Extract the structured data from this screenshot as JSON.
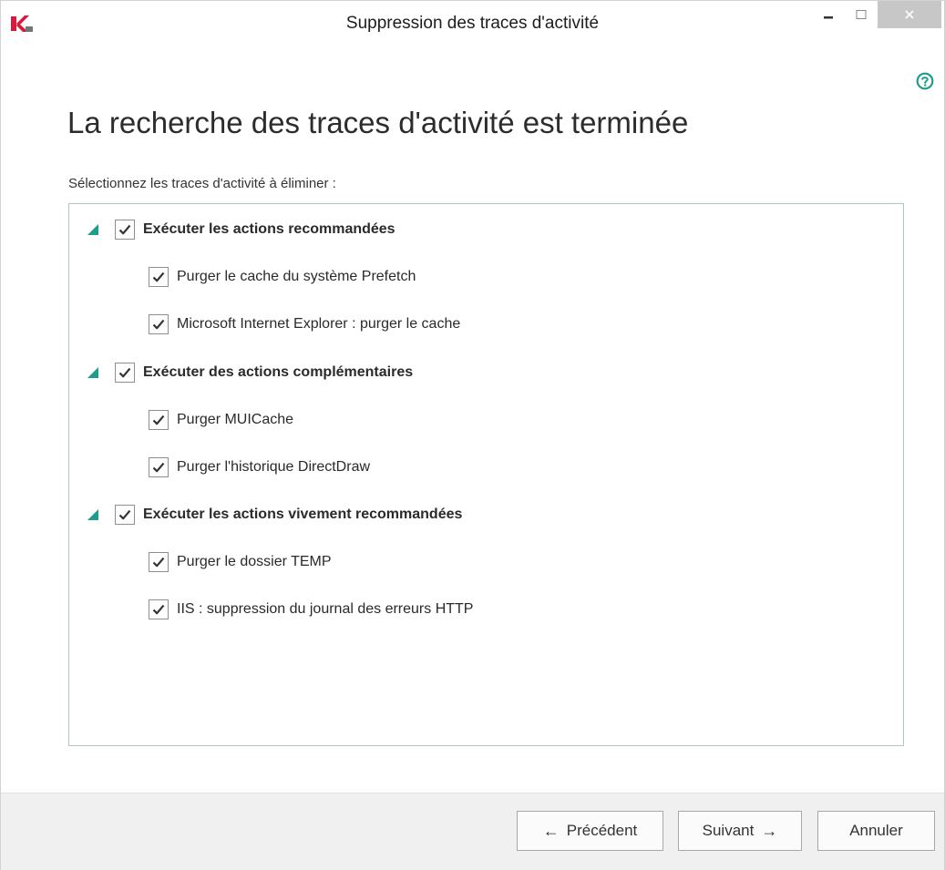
{
  "window": {
    "title": "Suppression des traces d'activité"
  },
  "header": {
    "title": "La recherche des traces d'activité est terminée",
    "subtitle": "Sélectionnez les traces d'activité à éliminer :"
  },
  "groups": [
    {
      "label": "Exécuter les actions recommandées",
      "checked": true,
      "items": [
        {
          "label": "Purger le cache du système Prefetch",
          "checked": true
        },
        {
          "label": "Microsoft Internet Explorer : purger le cache",
          "checked": true
        }
      ]
    },
    {
      "label": "Exécuter des actions complémentaires",
      "checked": true,
      "items": [
        {
          "label": "Purger MUICache",
          "checked": true
        },
        {
          "label": "Purger l'historique DirectDraw",
          "checked": true
        }
      ]
    },
    {
      "label": "Exécuter les actions vivement recommandées",
      "checked": true,
      "items": [
        {
          "label": "Purger le dossier TEMP",
          "checked": true
        },
        {
          "label": "IIS : suppression du journal des erreurs HTTP",
          "checked": true
        }
      ]
    }
  ],
  "footer": {
    "prev_label": "Précédent",
    "next_label": "Suivant",
    "cancel_label": "Annuler",
    "prev_arrow": "←",
    "next_arrow": "→"
  },
  "colors": {
    "accent": "#1f9c8a",
    "logo_red": "#d61a3c",
    "footer_bg": "#f0f0f0"
  },
  "icons": {
    "logo": "kaspersky-logo-icon",
    "help": "help-circle-icon",
    "expand": "expand-triangle-icon",
    "check": "checkmark-icon"
  }
}
